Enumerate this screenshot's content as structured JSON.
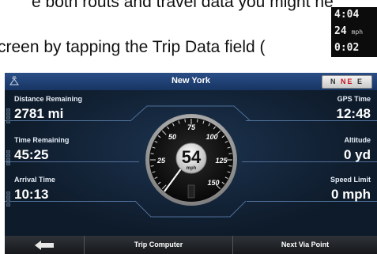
{
  "document": {
    "line1": "e both routs and travel data you might ne",
    "line2": "creen by tapping the Trip Data field (",
    "mini_widget": {
      "row1": "4:04",
      "row2": "24",
      "row2_unit": "mph",
      "row3": "0:02"
    }
  },
  "screen": {
    "title": "New York",
    "compass": {
      "n": "N",
      "ne": "NE",
      "e": "E"
    },
    "left_fields": [
      {
        "label": "Distance Remaining",
        "value": "2781 mi"
      },
      {
        "label": "Time Remaining",
        "value": "45:25"
      },
      {
        "label": "Arrival Time",
        "value": "10:13"
      }
    ],
    "right_fields": [
      {
        "label": "GPS Time",
        "value": "12:48"
      },
      {
        "label": "Altitude",
        "value": "0 yd"
      },
      {
        "label": "Speed Limit",
        "value": "0 mph"
      }
    ],
    "speedometer": {
      "value": "54",
      "unit": "mph",
      "scale": [
        "25",
        "50",
        "75",
        "100",
        "125",
        "150"
      ]
    },
    "bottom_bar": {
      "back_icon": "back-arrow-icon",
      "trip_computer": "Trip Computer",
      "next_via_point": "Next Via Point"
    },
    "colors": {
      "topbar": "#1f4176",
      "background": "#0e1b2a",
      "separator": "#4f6f99"
    }
  }
}
